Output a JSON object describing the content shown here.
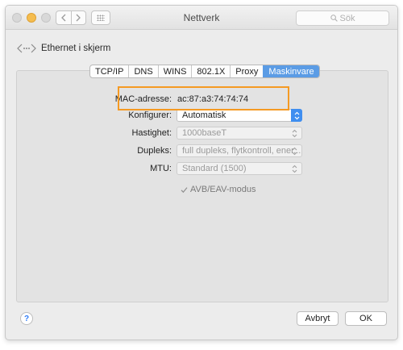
{
  "window": {
    "title": "Nettverk",
    "search_placeholder": "Sök",
    "nav_back_icon": "chevron-left-icon",
    "nav_forward_icon": "chevron-right-icon",
    "grid_icon": "show-all-grid-icon"
  },
  "header": {
    "service_name": "Ethernet i skjerm",
    "service_icon": "ethernet-icon"
  },
  "tabs": [
    {
      "label": "TCP/IP",
      "active": false
    },
    {
      "label": "DNS",
      "active": false
    },
    {
      "label": "WINS",
      "active": false
    },
    {
      "label": "802.1X",
      "active": false
    },
    {
      "label": "Proxy",
      "active": false
    },
    {
      "label": "Maskinvare",
      "active": true
    }
  ],
  "hardware": {
    "mac_label": "MAC-adresse:",
    "mac_value": "ac:87:a3:74:74:74",
    "configure_label": "Konfigurer:",
    "configure_value": "Automatisk",
    "speed_label": "Hastighet:",
    "speed_value": "1000baseT",
    "duplex_label": "Dupleks:",
    "duplex_value": "full dupleks, flytkontroll, ener...",
    "mtu_label": "MTU:",
    "mtu_value": "Standard  (1500)",
    "avb_label": "AVB/EAV-modus",
    "avb_checked": true
  },
  "footer": {
    "help_label": "?",
    "cancel_label": "Avbryt",
    "ok_label": "OK"
  },
  "colors": {
    "accent": "#3f8ef0",
    "tab_active": "#5b9ce5",
    "highlight": "#f59a23",
    "traffic_yellow": "#f5bd4f"
  }
}
